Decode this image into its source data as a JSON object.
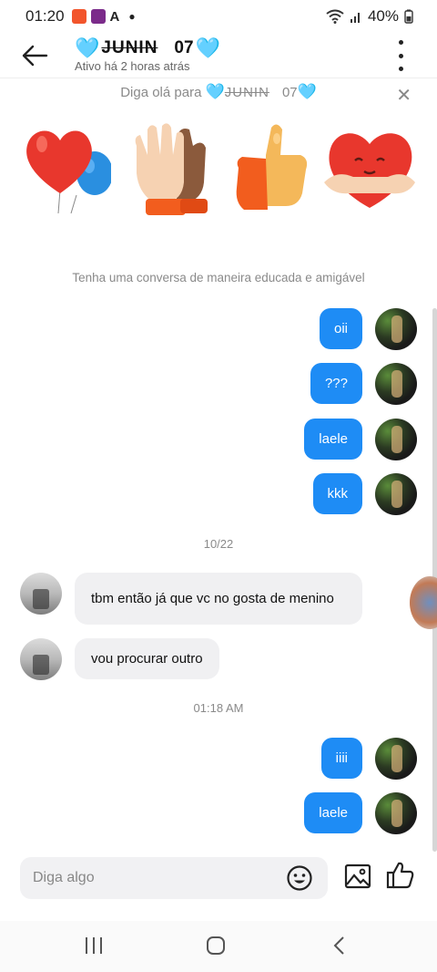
{
  "statusbar": {
    "time": "01:20",
    "battery": "40%"
  },
  "header": {
    "title_heart_left": "🩵",
    "title_name": "JUNIN",
    "title_number": "07",
    "title_heart_right": "🩵",
    "subtitle": "Ativo há 2 horas atrás"
  },
  "greeting": {
    "prefix": "Diga olá para ",
    "heart": "🩵",
    "name": "JUNIN",
    "number": "07",
    "heart2": "🩵",
    "close": "✕"
  },
  "stickers": [
    "heart-balloons-sticker",
    "high-five-sticker",
    "thumbs-up-sticker",
    "heart-hug-sticker"
  ],
  "hint": "Tenha uma conversa de maneira educada e amigável",
  "messages": [
    {
      "text": "oii",
      "from": "me"
    },
    {
      "text": "???",
      "from": "me"
    },
    {
      "text": "laele",
      "from": "me"
    },
    {
      "text": "kkk",
      "from": "me"
    },
    {
      "text": "tbm então já que vc no gosta de menino",
      "from": "other"
    },
    {
      "text": "vou procurar outro",
      "from": "other"
    },
    {
      "text": "iiii",
      "from": "me"
    },
    {
      "text": "laele",
      "from": "me"
    }
  ],
  "timestamps": {
    "first": "10/22",
    "second": "01:18 AM"
  },
  "input": {
    "placeholder": "Diga algo"
  },
  "colors": {
    "accent": "#1e8cf5",
    "heart": "#46d7f0"
  }
}
